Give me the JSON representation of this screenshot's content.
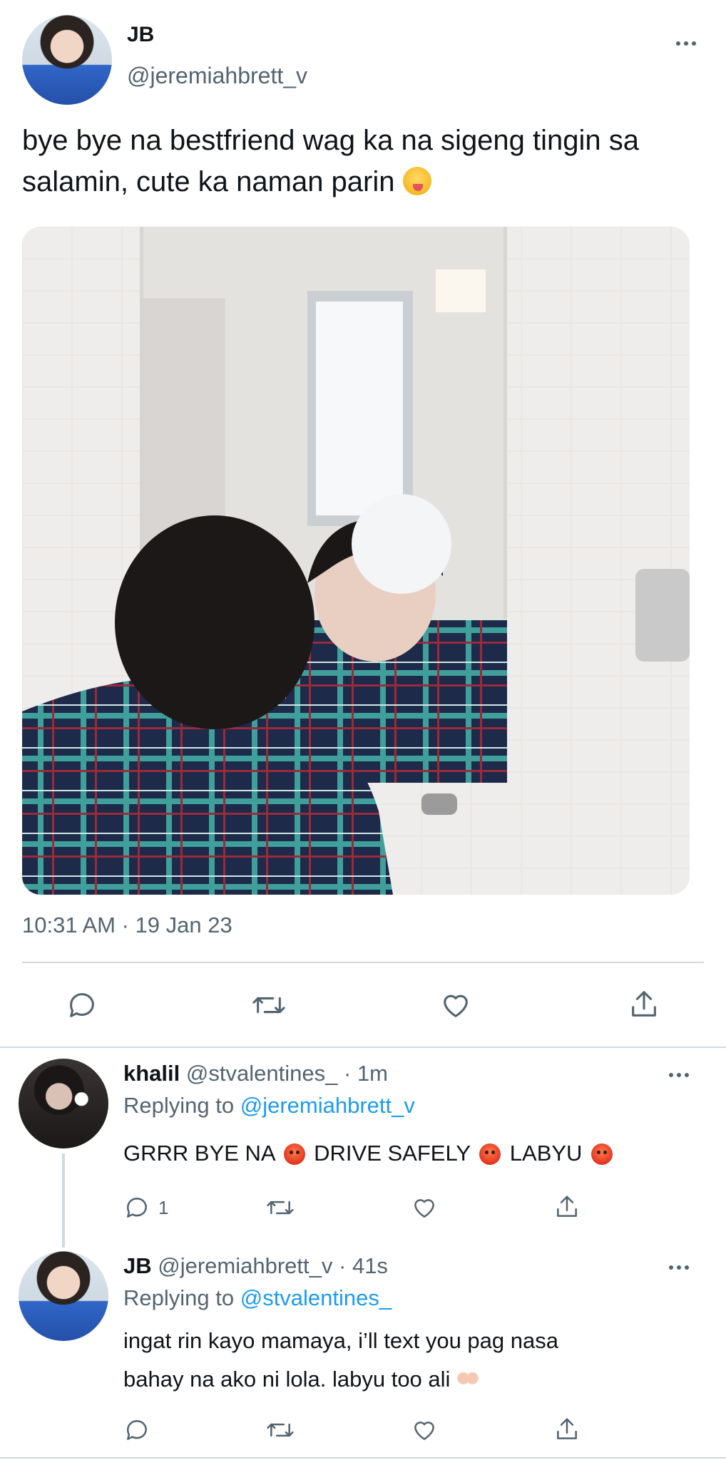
{
  "main_tweet": {
    "display_name": "JB",
    "handle": "@jeremiahbrett_v",
    "text": "bye bye na bestfriend wag ka na sigeng tingin sa salamin, cute ka naman parin",
    "timestamp": "10:31 AM · 19 Jan 23",
    "actions": {
      "reply_icon": "reply-icon",
      "retweet_icon": "retweet-icon",
      "like_icon": "like-icon",
      "share_icon": "share-icon"
    }
  },
  "replies": [
    {
      "display_name": "khalil",
      "handle": "@stvalentines_",
      "time": "· 1m",
      "replying_label": "Replying to",
      "replying_to": "@jeremiahbrett_v",
      "text_parts": [
        "GRRR BYE NA",
        "DRIVE SAFELY",
        "LABYU"
      ],
      "reply_count": "1"
    },
    {
      "display_name": "JB",
      "handle": "@jeremiahbrett_v",
      "time": "· 41s",
      "replying_label": "Replying to",
      "replying_to": "@stvalentines_",
      "text_line1": "ingat rin kayo mamaya, i’ll text you pag nasa",
      "text_line2": "bahay na ako ni lola. labyu too ali"
    }
  ],
  "colors": {
    "link": "#1d9bf0",
    "secondary_text": "#536471",
    "divider": "#cfd9de"
  }
}
